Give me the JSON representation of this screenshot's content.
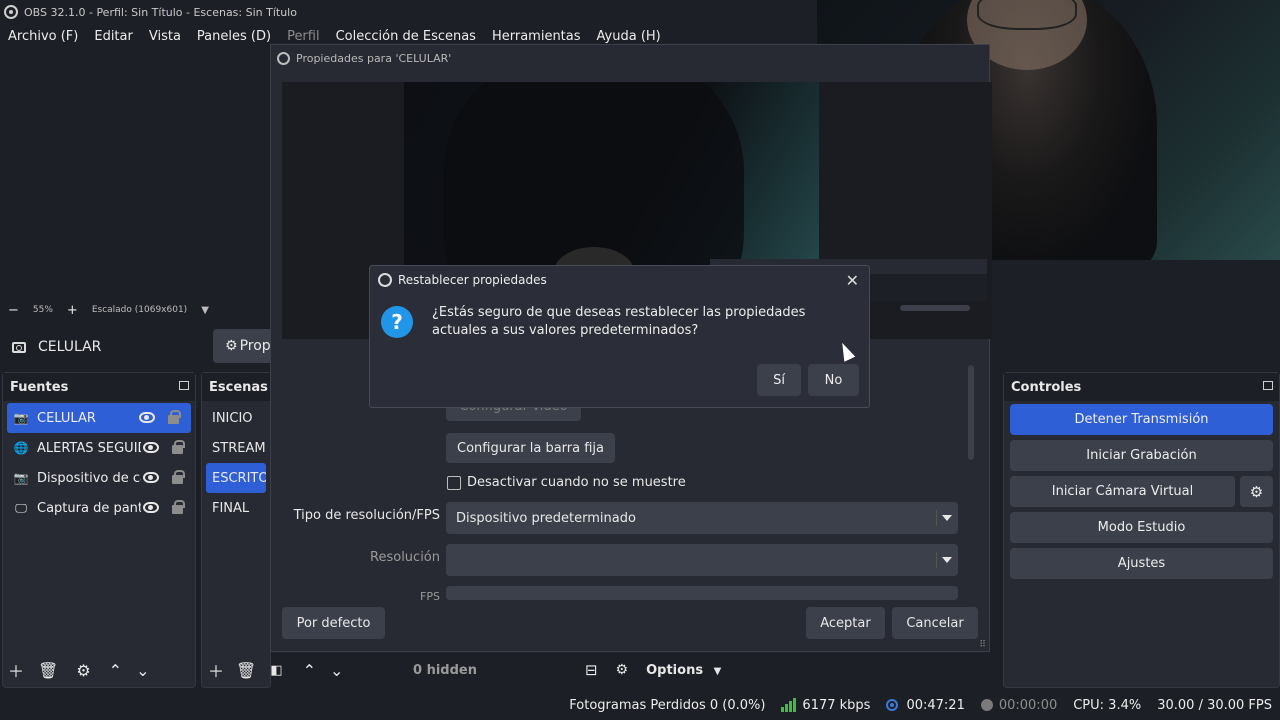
{
  "window": {
    "title": "OBS 32.1.0 - Perfil: Sin Título - Escenas: Sin Título"
  },
  "menu": {
    "items": [
      "Archivo (F)",
      "Editar",
      "Vista",
      "Paneles (D)",
      "Perfil",
      "Colección de Escenas",
      "Herramientas",
      "Ayuda (H)"
    ]
  },
  "zoombar": {
    "minus": "−",
    "zoom": "55%",
    "plus": "+",
    "scale": "Escalado (1069x601)"
  },
  "source_bar": {
    "current_source": "CELULAR",
    "properties_button": "Prop"
  },
  "properties_window": {
    "title": "Propiedades para 'CELULAR'",
    "configure_video_button": "Configurar video",
    "configure_bar_button": "Configurar la barra fija",
    "deactivate_checkbox_label": "Desactivar cuando no se muestre",
    "deactivate_checked": false,
    "resolution_type_label": "Tipo de resolución/FPS",
    "resolution_type_value": "Dispositivo predeterminado",
    "resolution_label": "Resolución",
    "resolution_value": "",
    "fps_label": "FPS",
    "defaults_button": "Por defecto",
    "accept_button": "Aceptar",
    "cancel_button": "Cancelar"
  },
  "dialog": {
    "title": "Restablecer propiedades",
    "message": "¿Estás seguro de que deseas restablecer las propiedades actuales a sus valores predeterminados?",
    "yes_button": "Sí",
    "no_button": "No",
    "close": "✕"
  },
  "sources": {
    "header": "Fuentes",
    "items": [
      {
        "name": "CELULAR",
        "icon": "camera-icon",
        "selected": true
      },
      {
        "name": "ALERTAS SEGUIDORES",
        "icon": "globe-icon",
        "selected": false
      },
      {
        "name": "Dispositivo de captura",
        "icon": "camera-icon",
        "selected": false
      },
      {
        "name": "Captura de pantalla",
        "icon": "monitor-icon",
        "selected": false
      }
    ]
  },
  "scenes": {
    "header": "Escenas",
    "items": [
      {
        "name": "INICIO",
        "selected": false
      },
      {
        "name": "STREAM",
        "selected": false
      },
      {
        "name": "ESCRITORIO",
        "selected": true
      },
      {
        "name": "FINAL",
        "selected": false
      }
    ]
  },
  "mixer": {
    "hidden_label": "0 hidden",
    "options_label": "Options"
  },
  "controls": {
    "header": "Controles",
    "stop_stream": "Detener Transmisión",
    "start_recording": "Iniciar Grabación",
    "start_virtual_cam": "Iniciar Cámara Virtual",
    "studio_mode": "Modo Estudio",
    "settings": "Ajustes"
  },
  "status": {
    "dropped_frames": "Fotogramas Perdidos 0 (0.0%)",
    "bitrate": "6177 kbps",
    "stream_time": "00:47:21",
    "record_time": "00:00:00",
    "cpu": "CPU: 3.4%",
    "fps": "30.00 / 30.00 FPS"
  },
  "colors": {
    "accent": "#2f5fd6",
    "background": "#1d1f26",
    "panel": "#272a33",
    "button": "#3c404b",
    "question_icon": "#2196e8",
    "signal_green": "#3fbf3f"
  }
}
